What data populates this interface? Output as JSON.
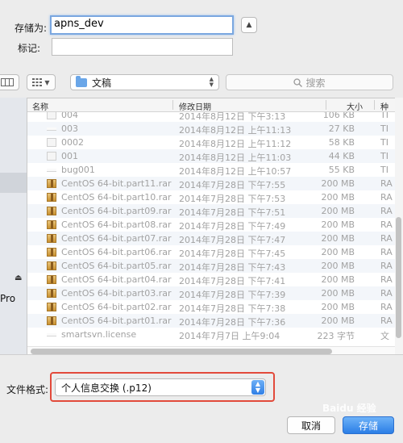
{
  "form": {
    "save_as_label": "存储为:",
    "save_as_value": "apns_dev",
    "tags_label": "标记:",
    "tags_value": ""
  },
  "toolbar": {
    "location": "文稿",
    "search_placeholder": "搜索"
  },
  "sidebar": {
    "eject_symbol": "⏏",
    "device_label": "Pro"
  },
  "columns": {
    "name": "名称",
    "date": "修改日期",
    "size": "大小",
    "kind": "种"
  },
  "files": [
    {
      "name": "004",
      "date": "2014年8月12日 下午3:13",
      "size": "106 KB",
      "kind": "TI",
      "icon": "doc-icon"
    },
    {
      "name": "003",
      "date": "2014年8月12日 上午11:13",
      "size": "27 KB",
      "kind": "TI",
      "icon": "blank-doc-icon"
    },
    {
      "name": "0002",
      "date": "2014年8月12日 上午11:12",
      "size": "58 KB",
      "kind": "TI",
      "icon": "doc-icon"
    },
    {
      "name": "001",
      "date": "2014年8月12日 上午11:03",
      "size": "44 KB",
      "kind": "TI",
      "icon": "doc-icon"
    },
    {
      "name": "bug001",
      "date": "2014年8月12日 上午10:57",
      "size": "55 KB",
      "kind": "TI",
      "icon": "blank-doc-icon"
    },
    {
      "name": "CentOS 64-bit.part11.rar",
      "date": "2014年7月28日 下午7:55",
      "size": "200 MB",
      "kind": "RA",
      "icon": "rar-icon"
    },
    {
      "name": "CentOS 64-bit.part10.rar",
      "date": "2014年7月28日 下午7:53",
      "size": "200 MB",
      "kind": "RA",
      "icon": "rar-icon"
    },
    {
      "name": "CentOS 64-bit.part09.rar",
      "date": "2014年7月28日 下午7:51",
      "size": "200 MB",
      "kind": "RA",
      "icon": "rar-icon"
    },
    {
      "name": "CentOS 64-bit.part08.rar",
      "date": "2014年7月28日 下午7:49",
      "size": "200 MB",
      "kind": "RA",
      "icon": "rar-icon"
    },
    {
      "name": "CentOS 64-bit.part07.rar",
      "date": "2014年7月28日 下午7:47",
      "size": "200 MB",
      "kind": "RA",
      "icon": "rar-icon"
    },
    {
      "name": "CentOS 64-bit.part06.rar",
      "date": "2014年7月28日 下午7:45",
      "size": "200 MB",
      "kind": "RA",
      "icon": "rar-icon"
    },
    {
      "name": "CentOS 64-bit.part05.rar",
      "date": "2014年7月28日 下午7:43",
      "size": "200 MB",
      "kind": "RA",
      "icon": "rar-icon"
    },
    {
      "name": "CentOS 64-bit.part04.rar",
      "date": "2014年7月28日 下午7:41",
      "size": "200 MB",
      "kind": "RA",
      "icon": "rar-icon"
    },
    {
      "name": "CentOS 64-bit.part03.rar",
      "date": "2014年7月28日 下午7:39",
      "size": "200 MB",
      "kind": "RA",
      "icon": "rar-icon"
    },
    {
      "name": "CentOS 64-bit.part02.rar",
      "date": "2014年7月28日 下午7:38",
      "size": "200 MB",
      "kind": "RA",
      "icon": "rar-icon"
    },
    {
      "name": "CentOS 64-bit.part01.rar",
      "date": "2014年7月28日 下午7:36",
      "size": "200 MB",
      "kind": "RA",
      "icon": "rar-icon"
    },
    {
      "name": "smartsvn.license",
      "date": "2014年7月7日 上午9:04",
      "size": "223 字节",
      "kind": "文",
      "icon": "blank-doc-icon"
    }
  ],
  "format": {
    "label": "文件格式:",
    "value": "个人信息交换 (.p12)",
    "highlight_color": "#e24a3b"
  },
  "buttons": {
    "cancel": "取消",
    "save": "存储"
  },
  "watermark": "Baidu 经验",
  "colors": {
    "accent": "#2f7fe6",
    "focus_ring": "#7aa7e0"
  }
}
